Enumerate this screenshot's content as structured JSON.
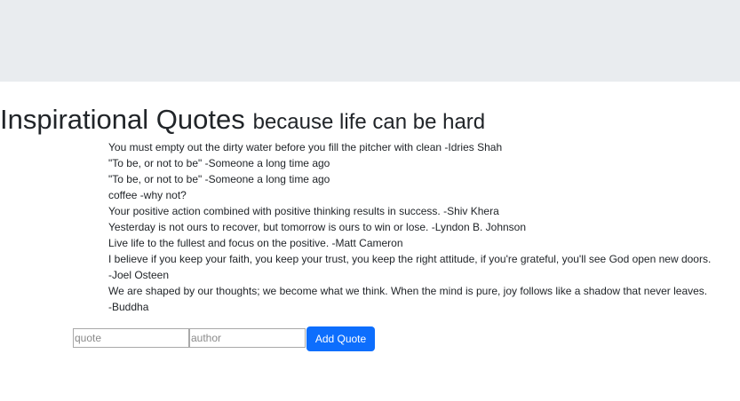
{
  "header": {
    "title": "Inspirational Quotes",
    "subtitle": "because life can be hard"
  },
  "quotes": [
    "You must empty out the dirty water before you fill the pitcher with clean -Idries Shah",
    "\"To be, or not to be\" -Someone a long time ago",
    "\"To be, or not to be\" -Someone a long time ago",
    "coffee -why not?",
    "Your positive action combined with positive thinking results in success. -Shiv Khera",
    "Yesterday is not ours to recover, but tomorrow is ours to win or lose. -Lyndon B. Johnson",
    "Live life to the fullest and focus on the positive. -Matt Cameron",
    "I believe if you keep your faith, you keep your trust, you keep the right attitude, if you're grateful, you'll see God open new doors.",
    "-Joel Osteen",
    "We are shaped by our thoughts; we become what we think. When the mind is pure, joy follows like a shadow that never leaves.",
    "-Buddha"
  ],
  "form": {
    "quote_placeholder": "quote",
    "quote_value": "",
    "author_placeholder": "author",
    "author_value": "",
    "add_label": "Add Quote"
  },
  "colors": {
    "banner_bg": "#e9ecef",
    "button_bg": "#0d6efd",
    "button_text": "#ffffff"
  }
}
